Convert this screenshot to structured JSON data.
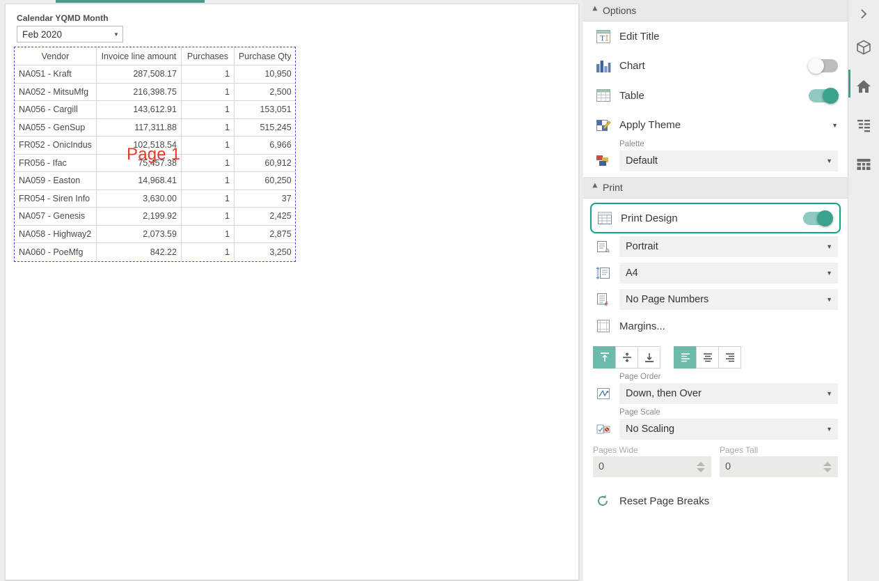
{
  "canvas": {
    "prompt": {
      "label": "Calendar YQMD Month",
      "value": "Feb 2020",
      "caret_icon": "chevron-down-icon"
    },
    "watermark": "Page 1",
    "table": {
      "columns": [
        "Vendor",
        "Invoice line amount",
        "Purchases",
        "Purchase Qty"
      ],
      "rows": [
        [
          "NA051 - Kraft",
          "287,508.17",
          "1",
          "10,950"
        ],
        [
          "NA052 - MitsuMfg",
          "216,398.75",
          "1",
          "2,500"
        ],
        [
          "NA056 - Cargill",
          "143,612.91",
          "1",
          "153,051"
        ],
        [
          "NA055 - GenSup",
          "117,311.88",
          "1",
          "515,245"
        ],
        [
          "FR052 - OnicIndus",
          "102,518.54",
          "1",
          "6,966"
        ],
        [
          "FR056 - Ifac",
          "75,457.38",
          "1",
          "60,912"
        ],
        [
          "NA059 - Easton",
          "14,968.41",
          "1",
          "60,250"
        ],
        [
          "FR054 - Siren Info",
          "3,630.00",
          "1",
          "37"
        ],
        [
          "NA057 - Genesis",
          "2,199.92",
          "1",
          "2,425"
        ],
        [
          "NA058 - Highway2",
          "2,073.59",
          "1",
          "2,875"
        ],
        [
          "NA060 - PoeMfg",
          "842.22",
          "1",
          "3,250"
        ]
      ]
    }
  },
  "panel": {
    "options": {
      "title": "Options",
      "edit_title": "Edit Title",
      "chart": "Chart",
      "chart_toggle_state": "off",
      "table": "Table",
      "table_toggle_state": "on",
      "apply_theme": "Apply Theme",
      "palette_label": "Palette",
      "palette_value": "Default"
    },
    "print": {
      "title": "Print",
      "print_design": "Print Design",
      "print_design_toggle_state": "on",
      "orientation": "Portrait",
      "paper_size": "A4",
      "page_numbers": "No Page Numbers",
      "margins": "Margins...",
      "page_order_label": "Page Order",
      "page_order_value": "Down, then Over",
      "page_scale_label": "Page Scale",
      "page_scale_value": "No Scaling",
      "pages_wide_label": "Pages Wide",
      "pages_wide_value": "0",
      "pages_tall_label": "Pages Tall",
      "pages_tall_value": "0",
      "reset_page_breaks": "Reset Page Breaks"
    }
  },
  "rail": {
    "items": [
      "expand-panel-icon",
      "cube-icon",
      "home-icon",
      "list-icon",
      "grid-icon"
    ]
  },
  "colors": {
    "accent_teal": "#3aa38e",
    "highlight_border": "#18a08b",
    "pagebreak_blue": "#3b46d6",
    "watermark_red": "#e8392b",
    "tab_bar": "#4a998e"
  }
}
